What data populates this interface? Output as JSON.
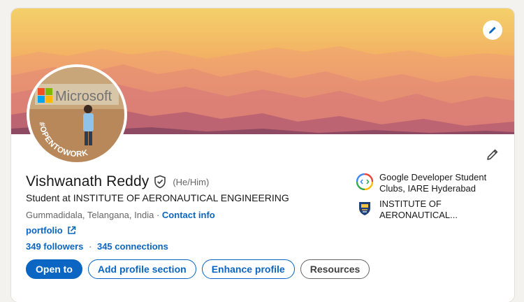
{
  "profile": {
    "name": "Vishwanath Reddy",
    "pronouns": "(He/Him)",
    "headline": "Student at INSTITUTE OF AERONAUTICAL ENGINEERING",
    "location": "Gummadidala, Telangana, India",
    "location_separator": "·",
    "contact_info_label": "Contact info",
    "portfolio_label": "portfolio",
    "followers_label": "349 followers",
    "stats_separator": "·",
    "connections_label": "345 connections",
    "avatar_badge_text": "#OPENTOWORK",
    "avatar_sign_text": "Microsoft"
  },
  "affiliations": [
    {
      "name": "Google Developer Student Clubs, IARE Hyderabad",
      "icon": "gdsc-logo"
    },
    {
      "name": "INSTITUTE OF AERONAUTICAL...",
      "icon": "iare-logo"
    }
  ],
  "actions": {
    "open_to": "Open to",
    "add_section": "Add profile section",
    "enhance": "Enhance profile",
    "resources": "Resources"
  },
  "colors": {
    "linkedin_blue": "#0a66c2",
    "open_to_work_green": "#2f6e3c",
    "banner_top": "#f1c76a",
    "banner_bottom": "#c96a78"
  }
}
